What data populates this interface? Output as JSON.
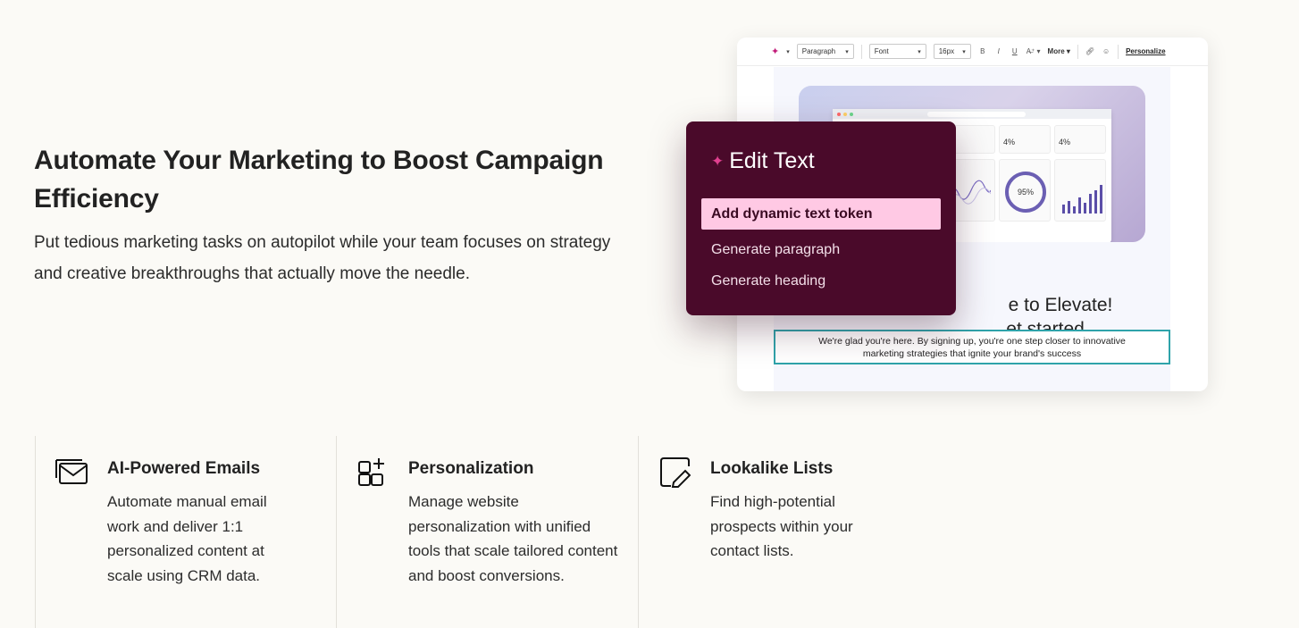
{
  "hero": {
    "title": "Automate Your Marketing to Boost Campaign Efficiency",
    "subtitle": "Put tedious marketing tasks on autopilot while your team focuses on strategy and creative breakthroughs that actually move the needle."
  },
  "editor": {
    "toolbar": {
      "paragraph": "Paragraph",
      "font": "Font",
      "size": "16px",
      "bold": "B",
      "italic": "I",
      "underline": "U",
      "more": "More",
      "personalize": "Personalize"
    },
    "preview": {
      "cards": [
        {
          "value": "%"
        },
        {
          "value": "4%"
        },
        {
          "value": "4%"
        }
      ],
      "ring_value": "95%"
    },
    "headline_line1": "e to Elevate!",
    "headline_line2": "et started.",
    "body_text": "We're glad you're here. By signing up, you're one step closer to innovative marketing strategies that ignite your brand's success"
  },
  "popup": {
    "title": "Edit Text",
    "items": [
      {
        "label": "Add dynamic text token",
        "active": true
      },
      {
        "label": "Generate paragraph",
        "active": false
      },
      {
        "label": "Generate heading",
        "active": false
      }
    ]
  },
  "features": [
    {
      "icon": "email-icon",
      "title": "AI-Powered Emails",
      "description": "Automate manual email work and deliver 1:1 personalized content at scale using CRM data."
    },
    {
      "icon": "add-widget-icon",
      "title": "Personalization",
      "description": "Manage website personalization with unified tools that scale tailored content and boost conversions."
    },
    {
      "icon": "edit-list-icon",
      "title": "Lookalike Lists",
      "description": "Find high-potential prospects within your contact lists."
    }
  ],
  "colors": {
    "background": "#fbfaf6",
    "popup_bg": "#4a0a2a",
    "popup_highlight": "#ffc9e4",
    "accent_pink": "#c21c7a",
    "teal_border": "#2fa3aa"
  }
}
